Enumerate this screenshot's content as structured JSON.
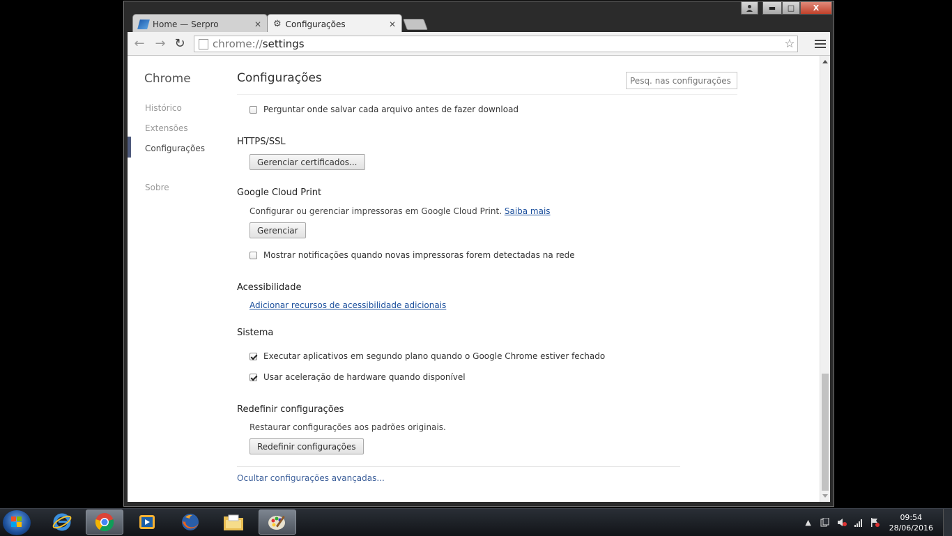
{
  "window": {
    "tabs": [
      {
        "title": "Home — Serpro",
        "icon": "serpro-icon",
        "active": false
      },
      {
        "title": "Configurações",
        "icon": "gear-icon",
        "active": true
      }
    ],
    "close_glyph": "✕",
    "controls": {
      "minimize": "▬",
      "maximize": "□",
      "close": "X"
    }
  },
  "toolbar": {
    "url_scheme": "chrome://",
    "url_host": "settings"
  },
  "sidebar": {
    "title": "Chrome",
    "items": [
      {
        "label": "Histórico"
      },
      {
        "label": "Extensões"
      },
      {
        "label": "Configurações"
      },
      {
        "label": "Sobre"
      }
    ]
  },
  "main": {
    "title": "Configurações",
    "search_placeholder": "Pesq. nas configurações",
    "download_ask_label": "Perguntar onde salvar cada arquivo antes de fazer download",
    "download_ask_checked": false,
    "https": {
      "heading": "HTTPS/SSL",
      "button": "Gerenciar certificados..."
    },
    "cloud_print": {
      "heading": "Google Cloud Print",
      "description": "Configurar ou gerenciar impressoras em Google Cloud Print.",
      "learn_more": "Saiba mais",
      "button": "Gerenciar",
      "notify_label": "Mostrar notificações quando novas impressoras forem detectadas na rede",
      "notify_checked": false
    },
    "accessibility": {
      "heading": "Acessibilidade",
      "link": "Adicionar recursos de acessibilidade adicionais"
    },
    "system": {
      "heading": "Sistema",
      "background_label": "Executar aplicativos em segundo plano quando o Google Chrome estiver fechado",
      "background_checked": true,
      "hw_accel_label": "Usar aceleração de hardware quando disponível",
      "hw_accel_checked": true
    },
    "reset": {
      "heading": "Redefinir configurações",
      "description": "Restaurar configurações aos padrões originais.",
      "button": "Redefinir configurações"
    },
    "hide_advanced": "Ocultar configurações avançadas..."
  },
  "taskbar": {
    "apps": [
      "internet-explorer",
      "chrome",
      "media-player",
      "firefox",
      "file-explorer",
      "paint"
    ],
    "active_apps": [
      "chrome",
      "paint"
    ],
    "clock_time": "09:54",
    "clock_date": "28/06/2016"
  },
  "colors": {
    "accent_link": "#1b4f9c",
    "sidebar_marker": "#4e5a7c"
  }
}
